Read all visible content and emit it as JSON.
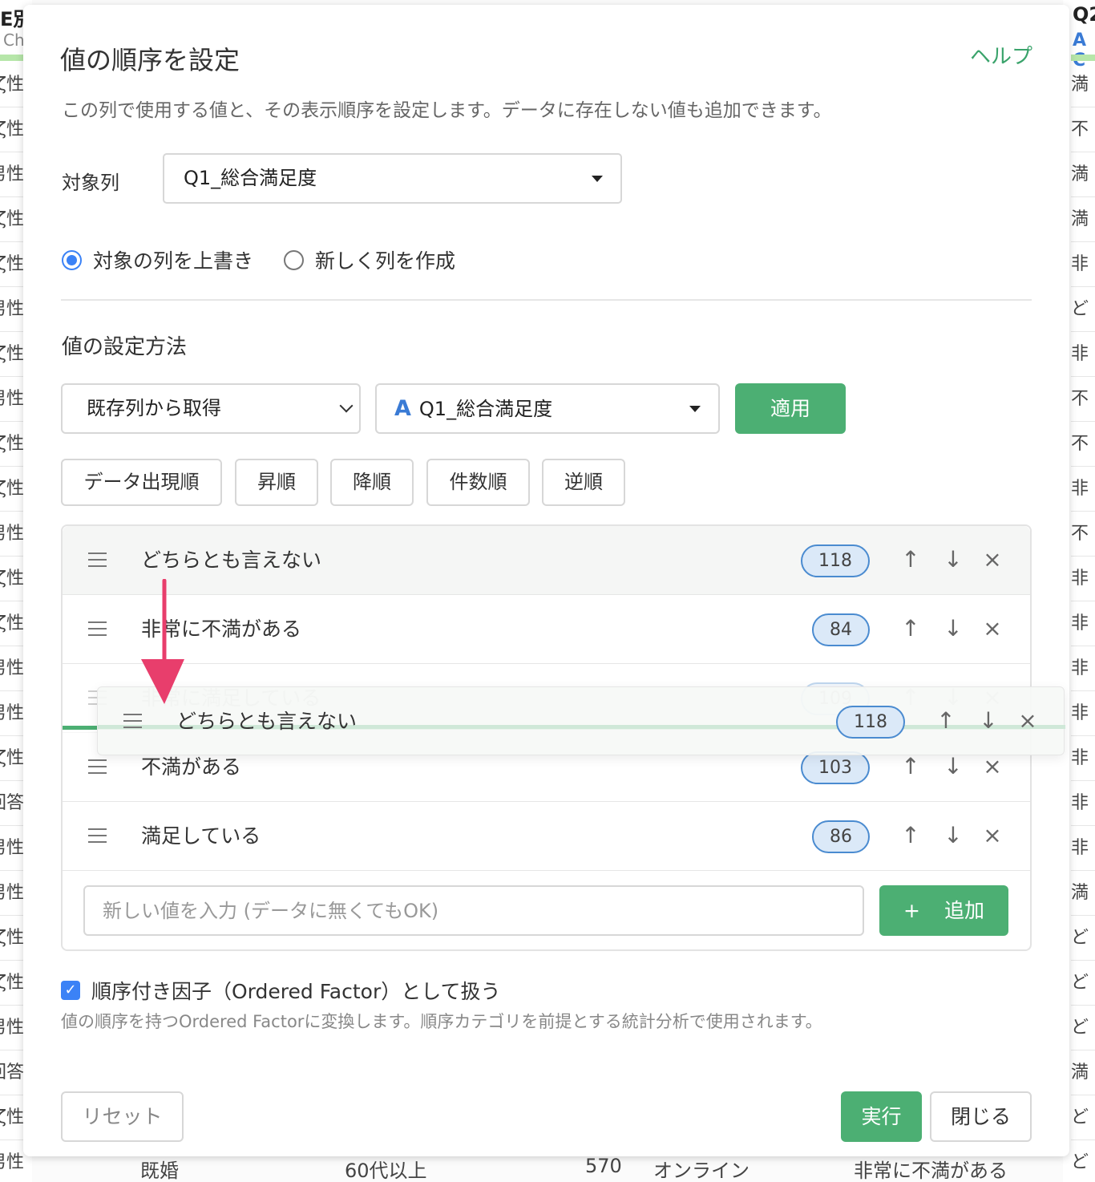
{
  "background": {
    "left_header": "E別",
    "left_sub": "Ch",
    "right_header": "Q2",
    "right_sub": "A C",
    "left_cells": [
      "ζ性",
      "ζ性",
      "男性",
      "ζ性",
      "ζ性",
      "男性",
      "ζ性",
      "男性",
      "ζ性",
      "ζ性",
      "男性",
      "ζ性",
      "ζ性",
      "男性",
      "男性",
      "ζ性",
      "回答",
      "男性",
      "男性",
      "ζ性",
      "ζ性",
      "男性",
      "回答",
      "ζ性",
      "男性"
    ],
    "right_cells": [
      "満",
      "不",
      "満",
      "満",
      "非",
      "ど",
      "非",
      "不",
      "不",
      "非",
      "不",
      "非",
      "非",
      "非",
      "非",
      "非",
      "非",
      "非",
      "満",
      "ど",
      "ど",
      "ど",
      "満",
      "ど",
      "ど"
    ],
    "bottom_row": [
      "既婚",
      "60代以上",
      "570",
      "オンライン",
      "非常に不満がある"
    ]
  },
  "modal": {
    "title": "値の順序を設定",
    "help": "ヘルプ",
    "description": "この列で使用する値と、その表示順序を設定します。データに存在しない値も追加できます。",
    "target_label": "対象列",
    "target_value": "Q1_総合満足度",
    "radio_overwrite": "対象の列を上書き",
    "radio_new": "新しく列を作成",
    "method_label": "値の設定方法",
    "method_value": "既存列から取得",
    "source_column_icon": "A",
    "source_column": "Q1_総合満足度",
    "apply": "適用",
    "sort_buttons": [
      "データ出現順",
      "昇順",
      "降順",
      "件数順",
      "逆順"
    ],
    "values": [
      {
        "label": "どちらとも言えない",
        "count": "118"
      },
      {
        "label": "非常に不満がある",
        "count": "84"
      },
      {
        "label": "非常に満足している",
        "count": "109"
      },
      {
        "label": "不満がある",
        "count": "103"
      },
      {
        "label": "満足している",
        "count": "86"
      }
    ],
    "dragging": {
      "label": "どちらとも言えない",
      "count": "118"
    },
    "new_value_placeholder": "新しい値を入力 (データに無くてもOK)",
    "add_button": "追加",
    "add_icon": "+",
    "ordered_label": "順序付き因子（Ordered Factor）として扱う",
    "ordered_desc": "値の順序を持つOrdered Factorに変換します。順序カテゴリを前提とする統計分析で使用されます。",
    "reset": "リセット",
    "run": "実行",
    "close": "閉じる",
    "icons": {
      "up": "↑",
      "down": "↓",
      "remove": "×",
      "check": "✓"
    }
  },
  "colors": {
    "accent_green": "#4caf73",
    "accent_blue": "#3b82f6",
    "drag_arrow": "#e83e6c"
  }
}
